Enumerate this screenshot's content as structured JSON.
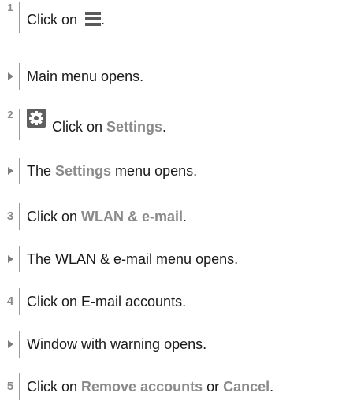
{
  "steps": [
    {
      "number": "1",
      "text_before": "Click on ",
      "text_after": "."
    },
    {
      "result": "Main menu opens."
    },
    {
      "number": "2",
      "text_before": "Click on ",
      "bold": "Settings",
      "text_after": "."
    },
    {
      "result_before": "The ",
      "result_bold": "Settings",
      "result_after": " menu opens."
    },
    {
      "number": "3",
      "text_before": "Click on ",
      "bold": "WLAN & e-mail",
      "text_after": "."
    },
    {
      "result": "The WLAN & e-mail menu opens."
    },
    {
      "number": "4",
      "text": "Click on E-mail accounts."
    },
    {
      "result": "Window with warning opens."
    },
    {
      "number": "5",
      "text_before": "Click on ",
      "bold": "Remove accounts",
      "text_middle": " or ",
      "bold2": "Cancel",
      "text_after": "."
    }
  ],
  "icons": {
    "menu": "hamburger-menu-icon",
    "settings": "gear-icon",
    "result_marker": "triangle-right-icon"
  },
  "colors": {
    "highlight": "#8a8a8a",
    "icon": "#5a5a5a"
  }
}
